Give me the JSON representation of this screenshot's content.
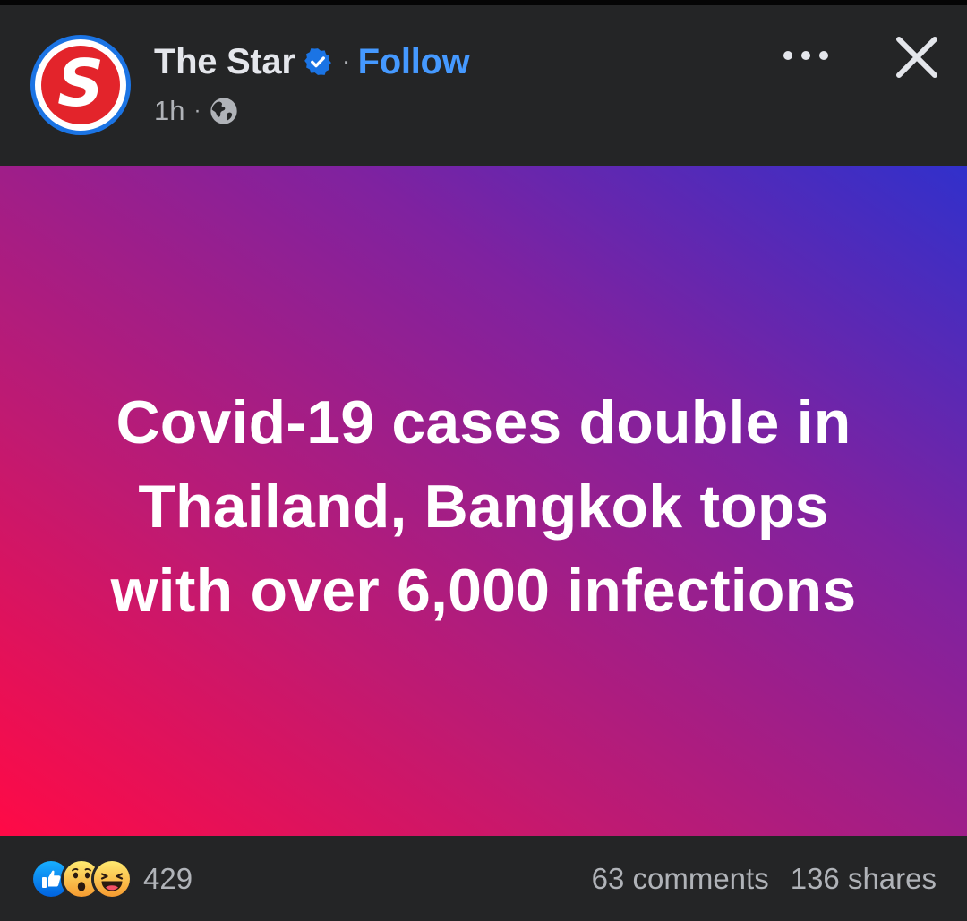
{
  "post": {
    "page_name": "The Star",
    "avatar_letter": "S",
    "separator": "·",
    "follow_label": "Follow",
    "timestamp": "1h",
    "audience_icon": "globe-icon",
    "more_icon": "ellipsis-icon",
    "close_icon": "close-icon",
    "verified_icon": "verified-badge-icon"
  },
  "banner": {
    "headline": "Covid-19 cases double in Thailand, Bangkok tops with over 6,000 infections",
    "gradient": [
      "#ff0a46",
      "#bf1a72",
      "#7f22a0",
      "#3130cb"
    ]
  },
  "footer": {
    "reaction_icons": [
      "like-icon",
      "wow-icon",
      "haha-icon"
    ],
    "reaction_count": "429",
    "comments": "63 comments",
    "shares": "136 shares"
  },
  "colors": {
    "background": "#242526",
    "text_primary": "#e4e6eb",
    "text_secondary": "#b0b3b8",
    "follow_blue": "#4599ff",
    "brand_red": "#e3242b",
    "verified_blue": "#1b74e4"
  }
}
